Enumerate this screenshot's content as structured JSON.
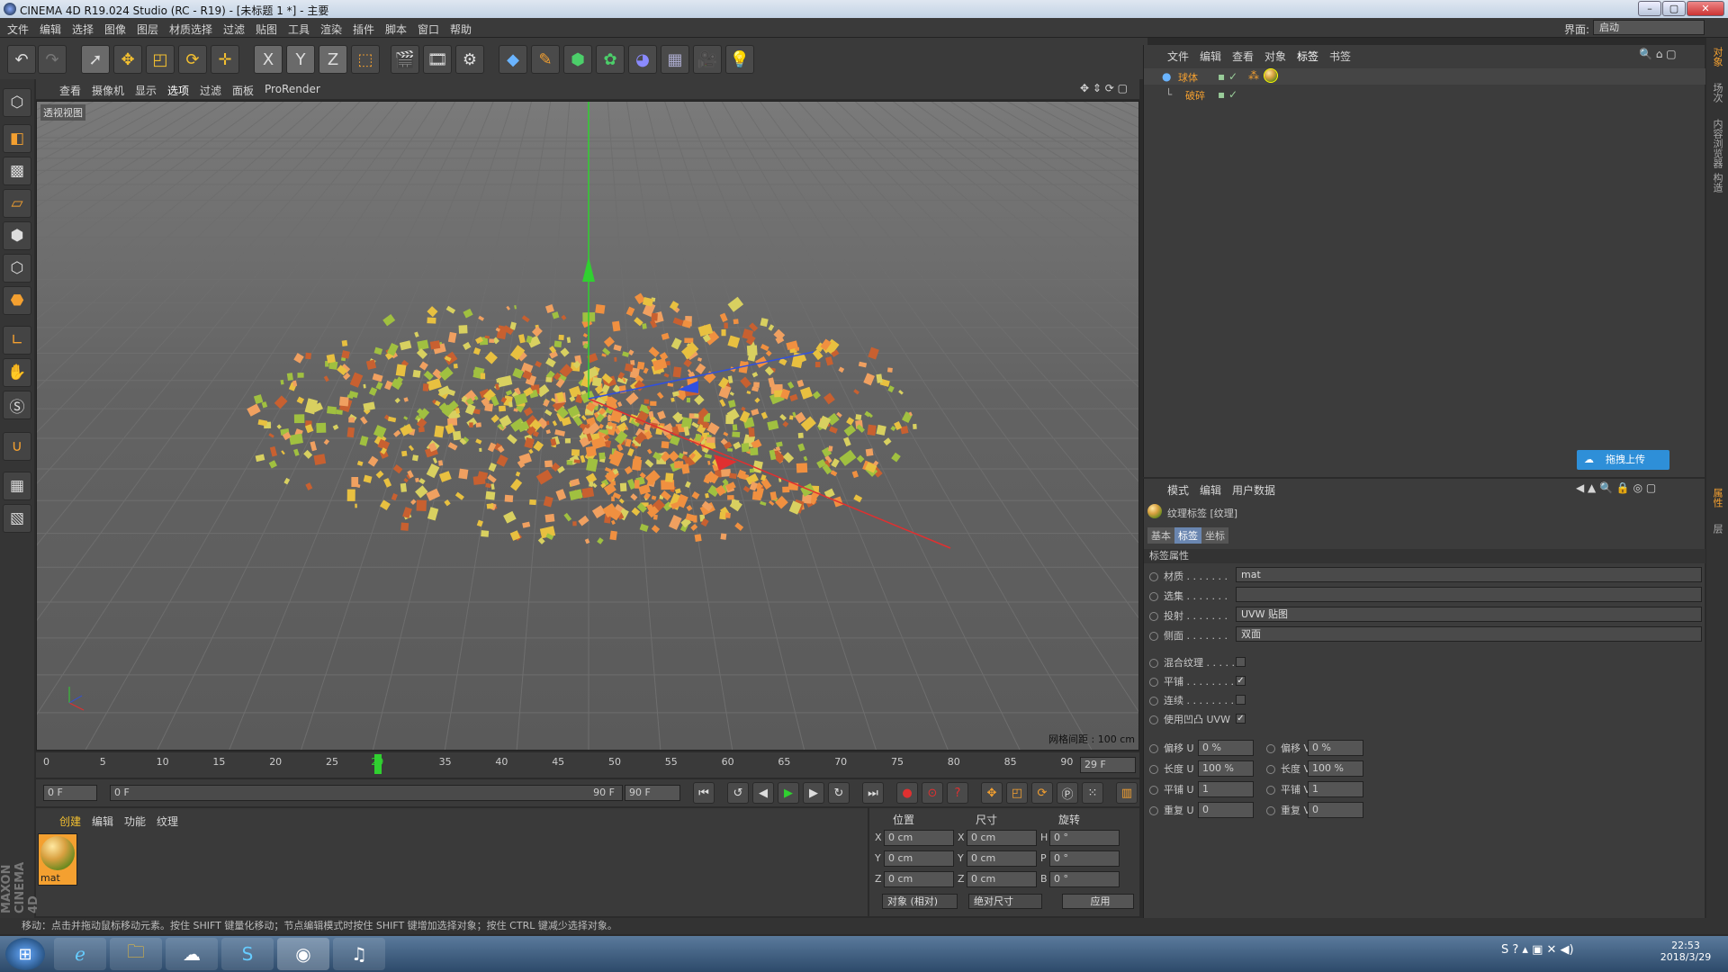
{
  "window": {
    "title": "CINEMA 4D R19.024 Studio (RC - R19) - [未标题 1 *] - 主要"
  },
  "menubar": {
    "items": [
      "文件",
      "编辑",
      "选择",
      "图像",
      "图层",
      "材质选择",
      "过滤",
      "贴图",
      "工具",
      "渲染",
      "插件",
      "脚本",
      "窗口",
      "帮助"
    ],
    "layout_label": "界面:",
    "layout_value": "启动"
  },
  "toolbar": {
    "icons": [
      "undo-icon",
      "redo-icon",
      "select-arrow-icon",
      "move-icon",
      "scale-icon",
      "rotate-icon",
      "live-selection-icon",
      "x-axis-icon",
      "y-axis-icon",
      "z-axis-icon",
      "coordinate-system-icon",
      "render-view-icon",
      "render-picture-viewer-icon",
      "render-settings-icon",
      "cube-icon",
      "pen-spline-icon",
      "subdivision-icon",
      "mograph-cloner-icon",
      "deformer-icon",
      "floor-icon",
      "camera-icon",
      "light-icon"
    ],
    "axis_labels": [
      "X",
      "Y",
      "Z"
    ]
  },
  "viewport": {
    "menu": [
      "查看",
      "摄像机",
      "显示",
      "选项",
      "过滤",
      "面板",
      "ProRender"
    ],
    "label": "透视视图",
    "grid_spacing": "网格间距 : 100 cm"
  },
  "timeline": {
    "ticks": [
      "0",
      "5",
      "10",
      "15",
      "20",
      "25",
      "29",
      "35",
      "40",
      "45",
      "50",
      "55",
      "60",
      "65",
      "70",
      "75",
      "80",
      "85",
      "90"
    ],
    "current_frame": 29,
    "end_field": "29 F"
  },
  "playback": {
    "start": "0 F",
    "range_start": "0 F",
    "range_end": "90 F",
    "end": "90 F"
  },
  "material_panel": {
    "tabs": [
      "创建",
      "编辑",
      "功能",
      "纹理"
    ],
    "material_name": "mat"
  },
  "coords": {
    "headers": [
      "位置",
      "尺寸",
      "旋转"
    ],
    "rows": [
      {
        "axis": "X",
        "pos": "0 cm",
        "sizeaxis": "X",
        "size": "0 cm",
        "rotaxis": "H",
        "rot": "0 °"
      },
      {
        "axis": "Y",
        "pos": "0 cm",
        "sizeaxis": "Y",
        "size": "0 cm",
        "rotaxis": "P",
        "rot": "0 °"
      },
      {
        "axis": "Z",
        "pos": "0 cm",
        "sizeaxis": "Z",
        "size": "0 cm",
        "rotaxis": "B",
        "rot": "0 °"
      }
    ],
    "mode1": "对象 (相对)",
    "mode2": "绝对尺寸",
    "apply": "应用"
  },
  "status": "移动：点击并拖动鼠标移动元素。按住 SHIFT 键量化移动；节点编辑模式时按住 SHIFT 键增加选择对象；按住 CTRL 键减少选择对象。",
  "object_manager": {
    "menu": [
      "文件",
      "编辑",
      "查看",
      "对象",
      "标签",
      "书签"
    ],
    "objects": [
      {
        "name": "球体"
      },
      {
        "name": "破碎"
      }
    ],
    "upload_button": "拖拽上传"
  },
  "attribute_manager": {
    "menu": [
      "模式",
      "编辑",
      "用户数据"
    ],
    "title": "纹理标签 [纹理]",
    "tabs": [
      "基本",
      "标签",
      "坐标"
    ],
    "section": "标签属性",
    "fields": [
      {
        "label": "材质 . . . . . . .",
        "value": "mat"
      },
      {
        "label": "选集 . . . . . . .",
        "value": ""
      },
      {
        "label": "投射 . . . . . . .",
        "value": "UVW 贴图"
      },
      {
        "label": "侧面 . . . . . . .",
        "value": "双面"
      }
    ],
    "checks": [
      {
        "label": "混合纹理 . . . . . .",
        "checked": false
      },
      {
        "label": "平铺 . . . . . . . .",
        "checked": true
      },
      {
        "label": "连续 . . . . . . . .",
        "checked": false
      },
      {
        "label": "使用凹凸 UVW",
        "checked": true
      }
    ],
    "pairs": [
      {
        "l1": "偏移 U",
        "v1": "0 %",
        "l2": "偏移 V",
        "v2": "0 %"
      },
      {
        "l1": "长度 U",
        "v1": "100 %",
        "l2": "长度 V",
        "v2": "100 %"
      },
      {
        "l1": "平铺 U",
        "v1": "1",
        "l2": "平铺 V",
        "v2": "1"
      },
      {
        "l1": "重复 U",
        "v1": "0",
        "l2": "重复 V",
        "v2": "0"
      }
    ]
  },
  "right_strip": [
    "对象",
    "场次",
    "内容浏览器",
    "构造",
    "属性",
    "层"
  ],
  "taskbar": {
    "clock": "22:53",
    "date": "2018/3/29"
  },
  "maxon_logo": "MAXON CINEMA 4D",
  "colors": {
    "x_axis": "#e03030",
    "y_axis": "#30d030",
    "z_axis": "#3050e0"
  }
}
